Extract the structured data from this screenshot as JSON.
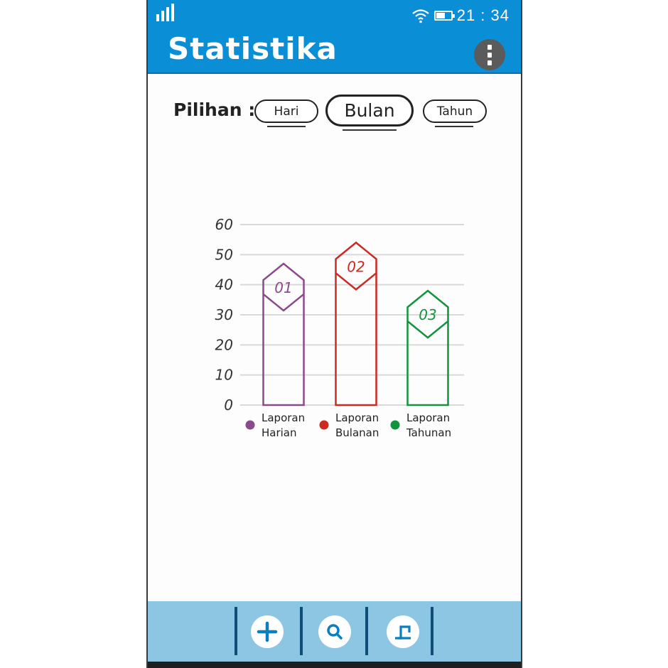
{
  "status_bar": {
    "time": "21 : 34"
  },
  "header": {
    "title": "Statistika"
  },
  "filter": {
    "label": "Pilihan :",
    "options": [
      "Hari",
      "Bulan",
      "Tahun"
    ],
    "selected": "Bulan"
  },
  "chart_data": {
    "type": "bar",
    "ylim": [
      0,
      60
    ],
    "yticks": [
      "0",
      "10",
      "20",
      "30",
      "40",
      "50",
      "60"
    ],
    "grid": true,
    "categories": [
      "Laporan Harian",
      "Laporan Bulanan",
      "Laporan Tahunan"
    ],
    "values": [
      47,
      54,
      38
    ],
    "badges": [
      "01",
      "02",
      "03"
    ],
    "legend": [
      {
        "line1": "Laporan",
        "line2": "Harian",
        "color": "#8b4a8b"
      },
      {
        "line1": "Laporan",
        "line2": "Bulanan",
        "color": "#cc2a22"
      },
      {
        "line1": "Laporan",
        "line2": "Tahunan",
        "color": "#13933d"
      }
    ],
    "colors": [
      "#8b4a8b",
      "#cc2a22",
      "#13933d"
    ]
  },
  "bottom_nav": {
    "items": [
      {
        "icon": "plus-icon"
      },
      {
        "icon": "search-icon"
      },
      {
        "icon": "exit-icon"
      }
    ]
  },
  "colors": {
    "header": "#0a8ed6",
    "bottom_bar": "#8dc6e2",
    "menu_button": "#5b5b5b"
  }
}
